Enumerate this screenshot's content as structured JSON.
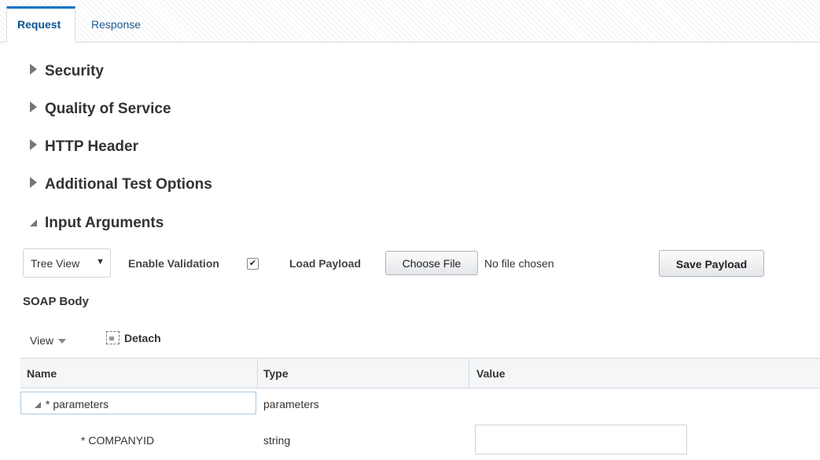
{
  "tabs": [
    {
      "label": "Request",
      "active": true
    },
    {
      "label": "Response",
      "active": false
    }
  ],
  "sections": [
    {
      "label": "Security",
      "expanded": false
    },
    {
      "label": "Quality of Service",
      "expanded": false
    },
    {
      "label": "HTTP Header",
      "expanded": false
    },
    {
      "label": "Additional Test Options",
      "expanded": false
    },
    {
      "label": "Input Arguments",
      "expanded": true
    }
  ],
  "input_toolbar": {
    "view_select": "Tree View",
    "enable_validation_label": "Enable Validation",
    "enable_validation_checked": true,
    "load_payload_label": "Load Payload",
    "choose_file_label": "Choose File",
    "no_file_text": "No file chosen",
    "save_payload_label": "Save Payload"
  },
  "soap_body_title": "SOAP Body",
  "table_toolbar": {
    "view_label": "View",
    "detach_label": "Detach"
  },
  "table": {
    "columns": [
      "Name",
      "Type",
      "Value"
    ],
    "rows": [
      {
        "name": "* parameters",
        "type": "parameters",
        "value": "",
        "expanded": true
      },
      {
        "name": "* COMPANYID",
        "type": "string",
        "value": ""
      }
    ]
  },
  "colors": {
    "accent": "#0b72c9",
    "tab_active_text": "#0b5594",
    "selection_border": "#a8c8e6"
  }
}
